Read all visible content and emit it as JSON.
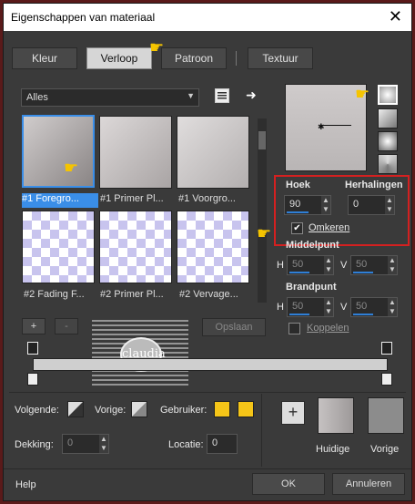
{
  "window": {
    "title": "Eigenschappen van materiaal",
    "close": "✕"
  },
  "tabs": [
    {
      "label": "Kleur",
      "active": false
    },
    {
      "label": "Verloop",
      "active": true
    },
    {
      "label": "Patroon",
      "active": false
    },
    {
      "label": "Textuur",
      "active": false
    }
  ],
  "category_select": {
    "value": "Alles"
  },
  "gradients": [
    {
      "caption": "#1 Foregro..."
    },
    {
      "caption": "#1 Primer Pl..."
    },
    {
      "caption": "#1 Voorgro..."
    },
    {
      "caption": "#2 Fading F..."
    },
    {
      "caption": "#2 Primer Pl..."
    },
    {
      "caption": "#2 Vervage..."
    }
  ],
  "left_buttons": {
    "add": "+",
    "remove": "-",
    "save": "Opslaan",
    "watermark_text": "claudia"
  },
  "angle": {
    "label": "Hoek",
    "value": "90"
  },
  "repeats": {
    "label": "Herhalingen",
    "value": "0"
  },
  "invert": {
    "label": "Omkeren",
    "checked": true
  },
  "center": {
    "label": "Middelpunt",
    "h_label": "H",
    "h_value": "50",
    "v_label": "V",
    "v_value": "50"
  },
  "focal": {
    "label": "Brandpunt",
    "h_label": "H",
    "h_value": "50",
    "v_label": "V",
    "v_value": "50"
  },
  "link": {
    "label": "Koppelen",
    "checked": false
  },
  "bottom": {
    "next_label": "Volgende:",
    "previous_label": "Vorige:",
    "user_label": "Gebruiker:",
    "user_colors": [
      "#f5c518",
      "#f5c518"
    ],
    "opacity_label": "Dekking:",
    "opacity_value": "0",
    "location_label": "Locatie:",
    "location_value": "0",
    "add_button": "+",
    "current_label": "Huidige",
    "previous_swatch_label": "Vorige"
  },
  "footer": {
    "help": "Help",
    "ok": "OK",
    "cancel": "Annuleren"
  },
  "colors": {
    "accent": "#3a8ee8",
    "highlight_box": "#d42020",
    "pointer": "#f5c400"
  },
  "icons": [
    "menu-icon",
    "arrow-right-icon",
    "hand-pointer-icon",
    "checkmark-icon"
  ]
}
